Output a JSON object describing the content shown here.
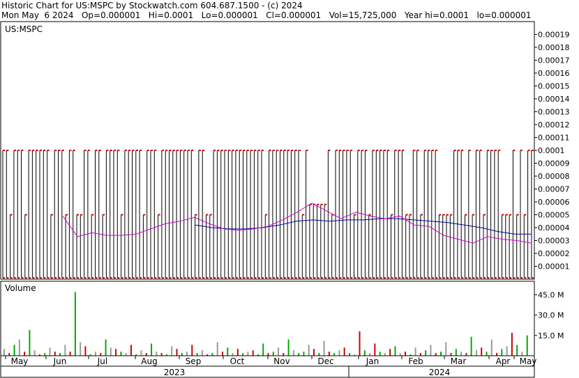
{
  "header": {
    "line1": "Historic Chart for US:MSPC by Stockwatch.com 604.687.1500 - (c) 2024",
    "line2": "Mon May  6 2024   Op=0.000001   Hi=0.0001   Lo=0.000001   Cl=0.000001   Vol=15,725,000   Year hi=0.0001   lo=0.000001"
  },
  "chart_data": [
    {
      "type": "line",
      "title": "US:MSPC",
      "x_labels": [
        "May",
        "Jun",
        "Jul",
        "Aug",
        "Sep",
        "Oct",
        "Nov",
        "Dec",
        "Jan",
        "Feb",
        "Mar",
        "Apr",
        "May"
      ],
      "year_labels": [
        "2023",
        "2024"
      ],
      "y_ticks": [
        "0.00019",
        "0.00018",
        "0.00017",
        "0.00016",
        "0.00015",
        "0.00014",
        "0.00013",
        "0.00012",
        "0.00011",
        "0.0001",
        "0.00009",
        "0.00008",
        "0.00007",
        "0.00006",
        "0.00005",
        "0.00004",
        "0.00003",
        "0.00002",
        "0.00001"
      ],
      "ylim": [
        0,
        0.0002
      ],
      "grid": true,
      "series": [
        {
          "kind": "price-bars",
          "color": "#000000",
          "close_color": "#cc0000"
        },
        {
          "kind": "moving-average-short",
          "color": "#cc00cc",
          "values": [
            4.9e-05,
            3.3e-05,
            3.6e-05,
            3.4e-05,
            3.4e-05,
            3.5e-05,
            3.9e-05,
            4.3e-05,
            4.5e-05,
            4.8e-05,
            4.3e-05,
            3.9e-05,
            3.8e-05,
            3.9e-05,
            4.1e-05,
            4.6e-05,
            5.2e-05,
            5.9e-05,
            5.3e-05,
            4.7e-05,
            5.2e-05,
            4.9e-05,
            4.7e-05,
            4.9e-05,
            4.2e-05,
            4.1e-05,
            3.4e-05,
            3.1e-05,
            2.8e-05,
            3.3e-05,
            3.1e-05,
            3e-05,
            2.8e-05
          ]
        },
        {
          "kind": "moving-average-long",
          "color": "#000099",
          "values": [
            4.2e-05,
            4e-05,
            3.9e-05,
            3.9e-05,
            4e-05,
            4.2e-05,
            4.5e-05,
            4.6e-05,
            4.5e-05,
            4.6e-05,
            4.6e-05,
            4.7e-05,
            4.7e-05,
            4.6e-05,
            4.5e-05,
            4.4e-05,
            4.2e-05,
            4e-05,
            3.7e-05,
            3.5e-05,
            3.5e-05
          ]
        }
      ]
    },
    {
      "type": "bar",
      "title": "Volume",
      "y_ticks": [
        "45.0 M",
        "30.0 M",
        "15.0 M"
      ],
      "ylim": [
        0,
        55000000
      ],
      "colors": {
        "up": "#00aa00",
        "down": "#cc0000",
        "flat": "#999999"
      },
      "values_millions": [
        5,
        2,
        8,
        12,
        3,
        19,
        4,
        1,
        2,
        6,
        3,
        2,
        8,
        3,
        47,
        10,
        7,
        1,
        3,
        2,
        12,
        6,
        5,
        3,
        2,
        8,
        1,
        4,
        2,
        9,
        3,
        2,
        1,
        7,
        5,
        2,
        3,
        8,
        2,
        4,
        1,
        2,
        10,
        3,
        6,
        2,
        5,
        2,
        3,
        4,
        1,
        9,
        2,
        3,
        6,
        2,
        12,
        4,
        2,
        3,
        8,
        5,
        2,
        11,
        3,
        2,
        4,
        6,
        2,
        1,
        18,
        4,
        2,
        9,
        3,
        2,
        5,
        7,
        2,
        3,
        1,
        6,
        2,
        4,
        8,
        2,
        3,
        10,
        2,
        5,
        3,
        2,
        14,
        4,
        6,
        3,
        12,
        2,
        5,
        7,
        17,
        8,
        3,
        15
      ]
    }
  ]
}
